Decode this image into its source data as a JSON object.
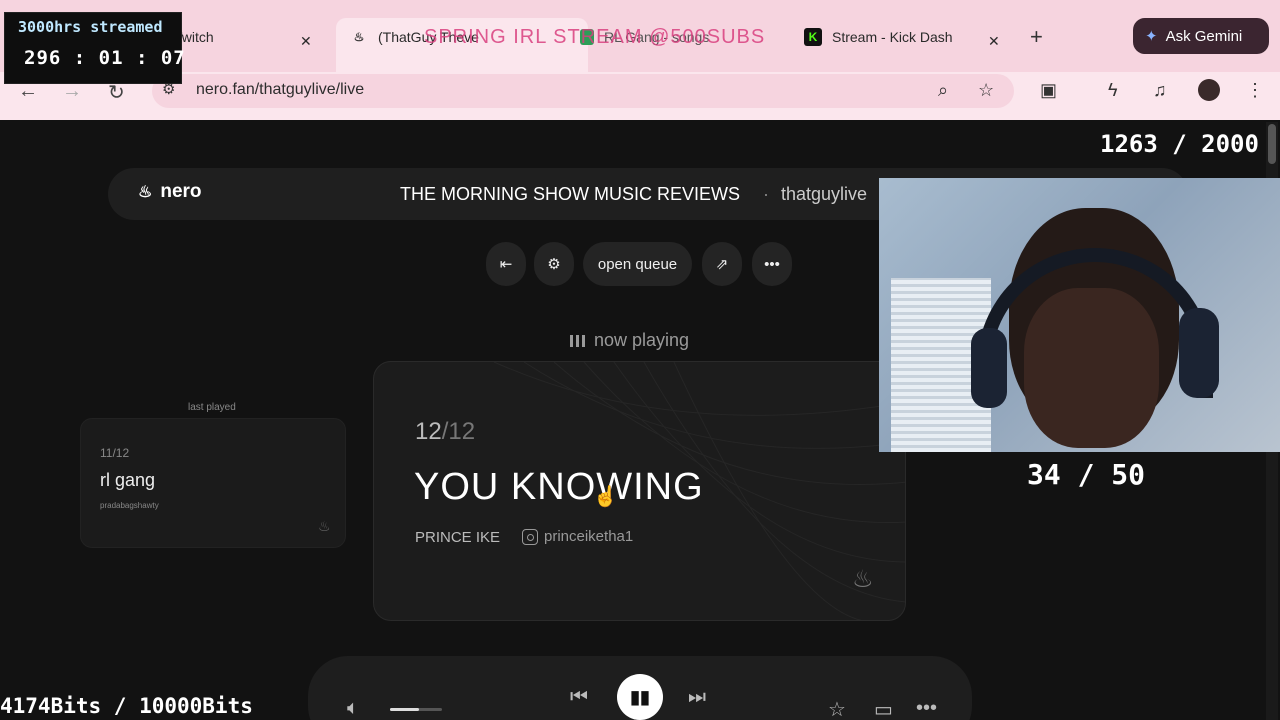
{
  "browser": {
    "tabs": [
      {
        "title": "Twitch",
        "close": "✕"
      },
      {
        "title": "(ThatGuy Theve",
        "close": ""
      },
      {
        "title": "RL Gang - songs",
        "close": ""
      },
      {
        "title": "Stream - Kick Dash",
        "close": "✕"
      }
    ],
    "new_tab": "+",
    "gemini_label": "Ask Gemini",
    "url": "nero.fan/thatguylive/live"
  },
  "overlay": {
    "banner": "SPRING IRL STREAM @500SUBS",
    "streamed_label": "3000hrs streamed",
    "streamed_time": "296 : 01 : 07",
    "goal_top": "1263 / 2000",
    "goal_mid": "34 / 50",
    "bits": "4174Bits / 10000Bits"
  },
  "nero": {
    "logo": "nero",
    "show_title": "THE MORNING SHOW MUSIC REVIEWS",
    "separator": "·",
    "host": "thatguylive",
    "open_queue": "open queue",
    "now_playing": "now playing",
    "last_played_label": "last played",
    "last": {
      "index": "11/12",
      "title": "rl gang",
      "artist": "pradabagshawty"
    },
    "current": {
      "index": "12",
      "total": "/12",
      "title": "YOU KNOWING",
      "artist": "PRINCE IKE",
      "instagram": "princeiketha1"
    },
    "volume_level": 0.55
  },
  "colors": {
    "accent": "#f6d4df",
    "banner": "#d9407f",
    "background": "#121212"
  }
}
